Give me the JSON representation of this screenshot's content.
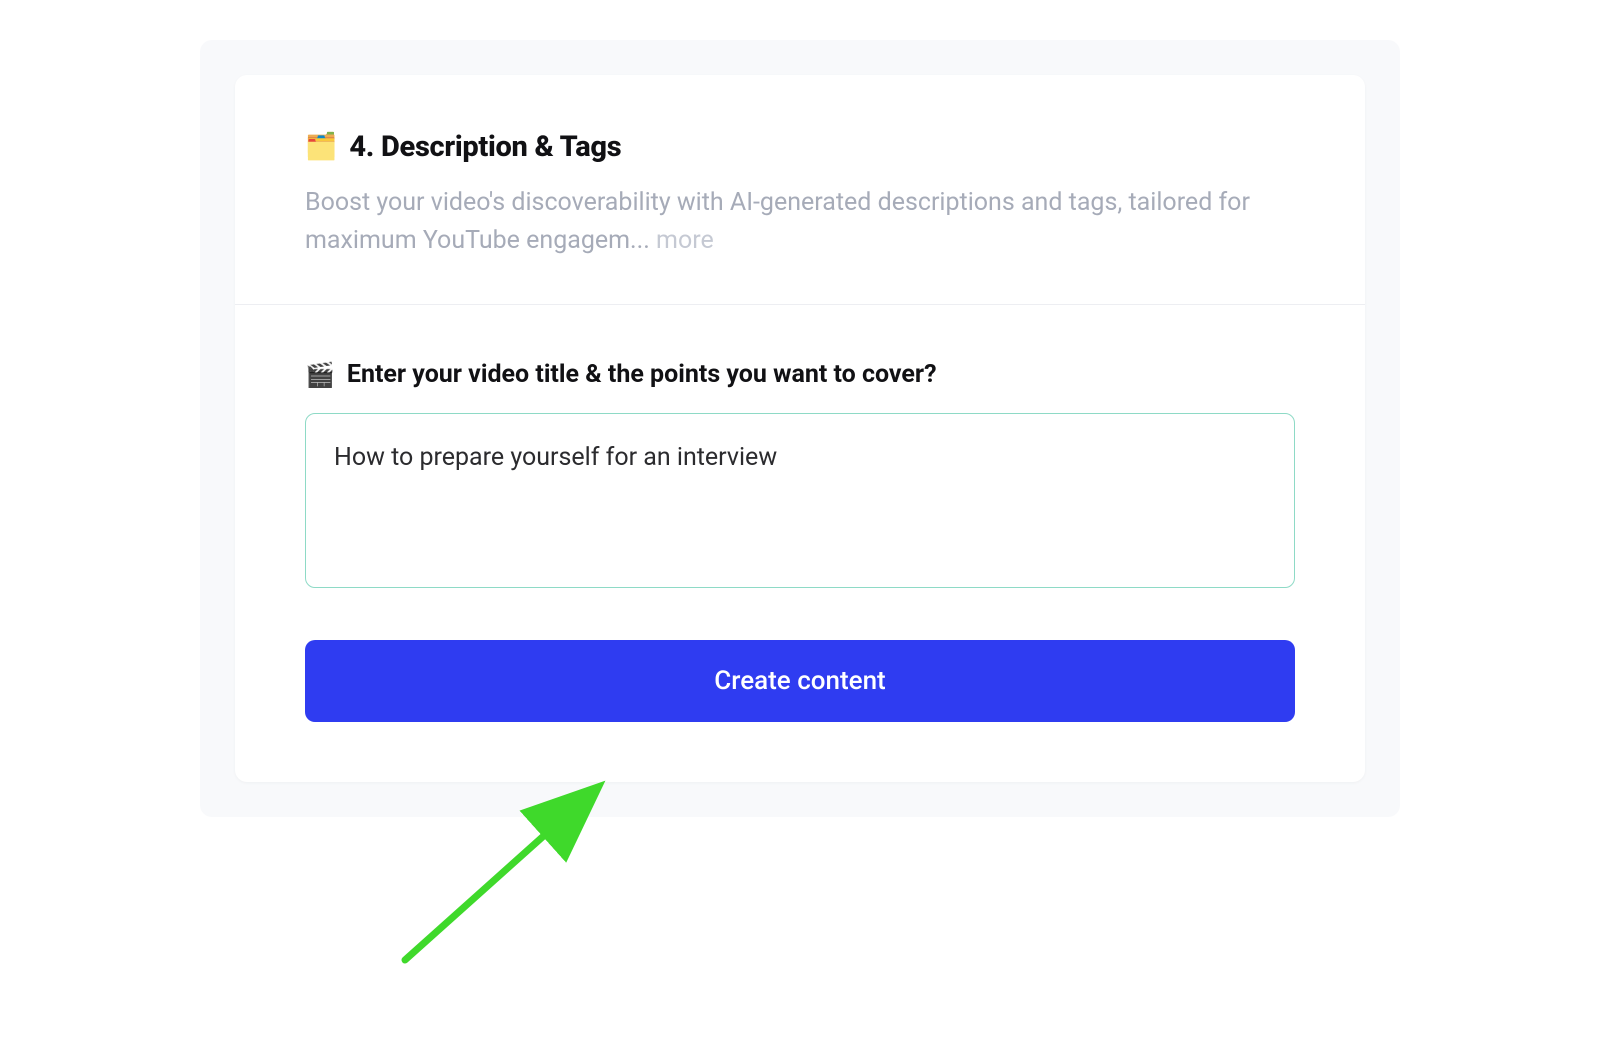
{
  "section": {
    "icon": "🗂️",
    "title": "4. Description & Tags",
    "description": "Boost your video's discoverability with AI-generated descriptions and tags, tailored for maximum YouTube engagem... ",
    "more_label": "more"
  },
  "input": {
    "icon": "🎬",
    "label": "Enter your video title & the points you want to cover?",
    "value": "How to prepare yourself for an interview"
  },
  "button": {
    "label": "Create content"
  },
  "colors": {
    "primary": "#2f3cf1",
    "input_border": "#8edac6",
    "annotation": "#3fd92b"
  }
}
